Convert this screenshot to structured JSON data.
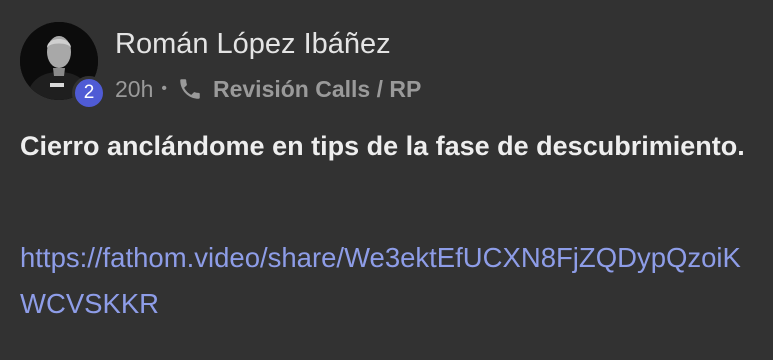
{
  "author": {
    "name": "Román López Ibáñez",
    "level": "2"
  },
  "meta": {
    "time": "20h",
    "separator": "•",
    "icon": "phone-icon",
    "category": "Revisión Calls / RP"
  },
  "post": {
    "text": "Cierro anclándome en tips de la fase de descubrimiento.",
    "link": "https://fathom.video/share/We3ektEfUCXN8FjZQDypQzoiKWCVSKKR"
  },
  "colors": {
    "background": "#323232",
    "badge": "#4f5bd5",
    "link": "#8e9de8"
  }
}
